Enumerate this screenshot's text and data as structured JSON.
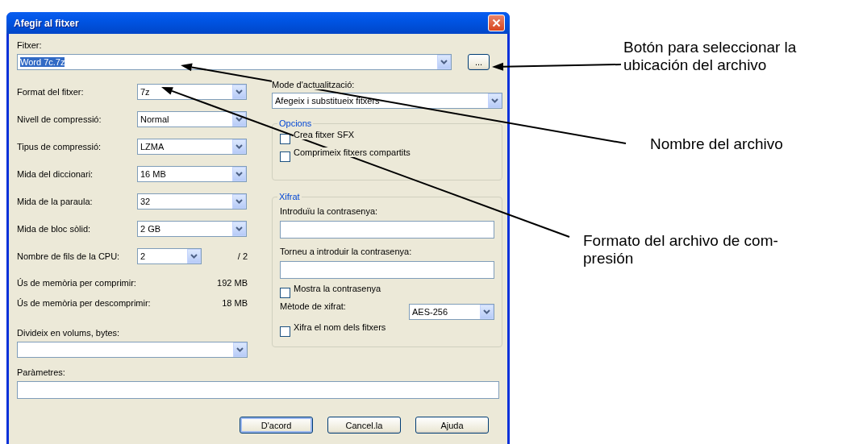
{
  "window": {
    "title": "Afegir al fitxer"
  },
  "file": {
    "label": "Fitxer:",
    "value": "Word 7c.7z",
    "value_selected": true
  },
  "browse_button": {
    "label": "..."
  },
  "settings": [
    {
      "label": "Format del fitxer:",
      "value": "7z"
    },
    {
      "label": "Nivell de compressió:",
      "value": "Normal"
    },
    {
      "label": "Tipus de compressió:",
      "value": "LZMA"
    },
    {
      "label": "Mida del diccionari:",
      "value": "16 MB"
    },
    {
      "label": "Mida de la paraula:",
      "value": "32"
    },
    {
      "label": "Mida de bloc sòlid:",
      "value": "2 GB"
    },
    {
      "label": "Nombre de fils de la CPU:",
      "value": "2",
      "suffix": "/ 2"
    }
  ],
  "memory": [
    {
      "label": "Ús de memòria per comprimir:",
      "value": "192 MB"
    },
    {
      "label": "Ús de memòria per descomprimir:",
      "value": "18 MB"
    }
  ],
  "volumes": {
    "label": "Divideix en volums, bytes:"
  },
  "update_mode": {
    "label": "Mode d'actualització:",
    "value": "Afegeix i substitueix fitxers"
  },
  "options": {
    "title": "Opcions",
    "checkboxes": [
      {
        "label": "Crea fitxer SFX",
        "checked": false
      },
      {
        "label": "Comprimeix fitxers compartits",
        "checked": false
      }
    ]
  },
  "encryption": {
    "title": "Xifrat",
    "password_label": "Introduïu la contrasenya:",
    "repeat_label": "Torneu a introduir la contrasenya:",
    "show_password": {
      "label": "Mostra la contrasenya",
      "checked": false
    },
    "method": {
      "label": "Mètode de xifrat:",
      "value": "AES-256"
    },
    "encrypt_names": {
      "label": "Xifra el nom dels fitxers",
      "checked": false
    }
  },
  "parameters": {
    "label": "Paràmetres:"
  },
  "buttons": [
    {
      "label": "D'acord",
      "default": true
    },
    {
      "label": "Cancel.la",
      "default": false
    },
    {
      "label": "Ajuda",
      "default": false
    }
  ],
  "annotations": [
    {
      "lines": [
        "Botón para seleccionar la",
        "ubicación del archivo"
      ]
    },
    {
      "lines": [
        "Nombre del archivo"
      ]
    },
    {
      "lines": [
        "Formato del archivo de com-",
        "presión"
      ]
    }
  ]
}
